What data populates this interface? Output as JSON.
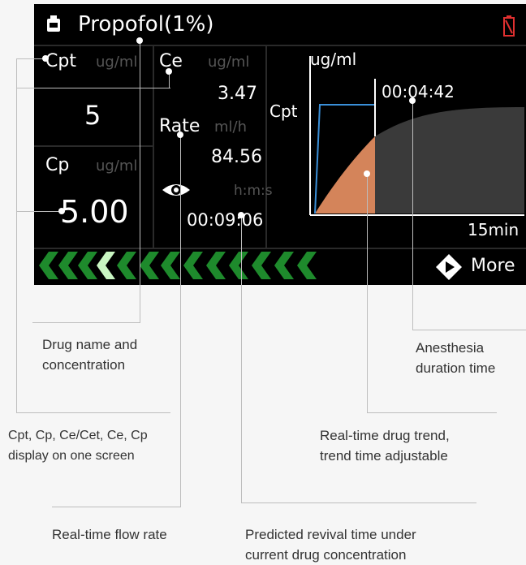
{
  "device": {
    "drug_title": "Propofol(1%)",
    "icons": {
      "drug": "syringe-icon",
      "battery": "battery-low-icon",
      "eye": "eye-icon",
      "more": "play-circle-icon"
    },
    "cpt": {
      "label": "Cpt",
      "unit": "ug/ml",
      "value": "5"
    },
    "cp": {
      "label": "Cp",
      "unit": "ug/ml",
      "value": "5.00"
    },
    "ce": {
      "label": "Ce",
      "unit": "ug/ml",
      "value": "3.47"
    },
    "rate": {
      "label": "Rate",
      "unit": "ml/h",
      "value": "84.56"
    },
    "revival": {
      "unit": "h:m:s",
      "value": "00:09:06"
    },
    "trend": {
      "unit": "ug/ml",
      "cpt_label": "Cpt",
      "elapsed": "00:04:42",
      "span": "15min"
    },
    "more_label": "More",
    "colors": {
      "chevron": "#1e8a2c",
      "chevron_active": "#c9f5c2",
      "trend_fill": "#d4845a",
      "trend_line": "#3a8fd8",
      "projection": "#3a3a3a",
      "battery": "#e03030"
    }
  },
  "callouts": {
    "drug_name": [
      "Drug name and",
      "concentration"
    ],
    "duration": [
      "Anesthesia",
      "duration time"
    ],
    "display": [
      "Cpt, Cp, Ce/Cet, Ce, Cp",
      "display on one screen"
    ],
    "trend": [
      "Real-time drug trend,",
      "trend time adjustable"
    ],
    "flow": [
      "Real-time flow rate"
    ],
    "revival": [
      "Predicted revival time under",
      "current drug concentration"
    ]
  }
}
